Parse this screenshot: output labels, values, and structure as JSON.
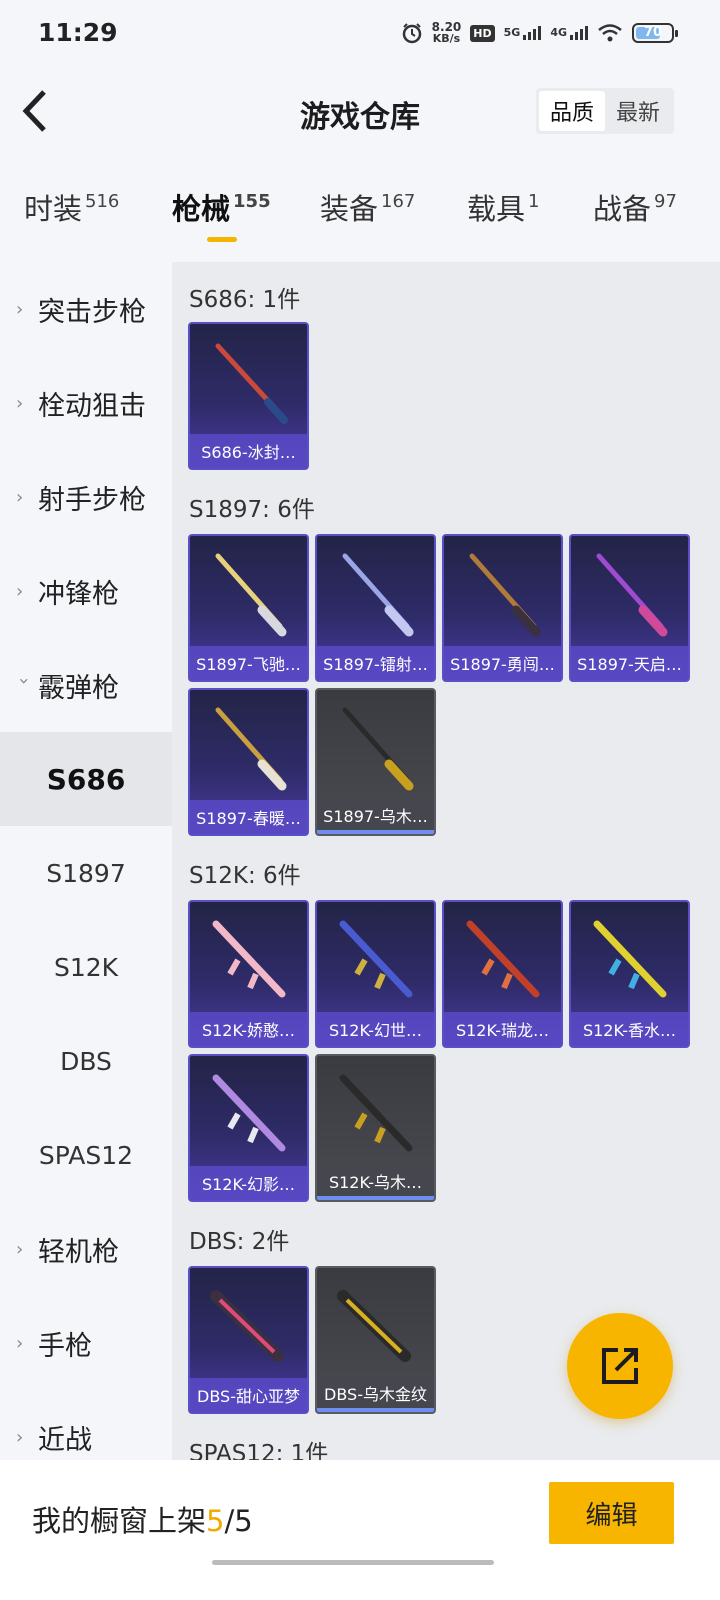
{
  "status": {
    "time": "11:29",
    "speed_value": "8.20",
    "speed_unit": "KB/s",
    "hd_label": "HD",
    "net1": "5G",
    "net2": "4G",
    "battery": "70"
  },
  "header": {
    "title": "游戏仓库",
    "sort_options": [
      "品质",
      "最新"
    ]
  },
  "tabs": [
    {
      "label": "时装",
      "count": "516"
    },
    {
      "label": "枪械",
      "count": "155"
    },
    {
      "label": "装备",
      "count": "167"
    },
    {
      "label": "载具",
      "count": "1"
    },
    {
      "label": "战备",
      "count": "97"
    }
  ],
  "sidebar": {
    "categories": [
      "突击步枪",
      "栓动狙击",
      "射手步枪",
      "冲锋枪",
      "霰弹枪"
    ],
    "subitems": [
      "S686",
      "S1897",
      "S12K",
      "DBS",
      "SPAS12"
    ],
    "more_categories": [
      "轻机枪",
      "手枪",
      "近战"
    ]
  },
  "sections": [
    {
      "title": "S686: 1件",
      "items": [
        "S686-冰封…"
      ]
    },
    {
      "title": "S1897: 6件",
      "items": [
        "S1897-飞驰…",
        "S1897-镭射…",
        "S1897-勇闯…",
        "S1897-天启…",
        "S1897-春暖…",
        "S1897-乌木…"
      ]
    },
    {
      "title": "S12K: 6件",
      "items": [
        "S12K-娇憨…",
        "S12K-幻世…",
        "S12K-瑞龙…",
        "S12K-香水…",
        "S12K-幻影…",
        "S12K-乌木…"
      ]
    },
    {
      "title": "DBS: 2件",
      "items": [
        "DBS-甜心亚梦",
        "DBS-乌木金纹"
      ]
    },
    {
      "title": "SPAS12: 1件",
      "items": []
    }
  ],
  "bottom": {
    "label_prefix": "我的橱窗上架",
    "current": "5",
    "total": "/5",
    "edit_label": "编辑"
  },
  "colors": {
    "accent": "#f7b500",
    "card_purple": "#4a3aa0",
    "card_grey": "#4a4b52"
  }
}
